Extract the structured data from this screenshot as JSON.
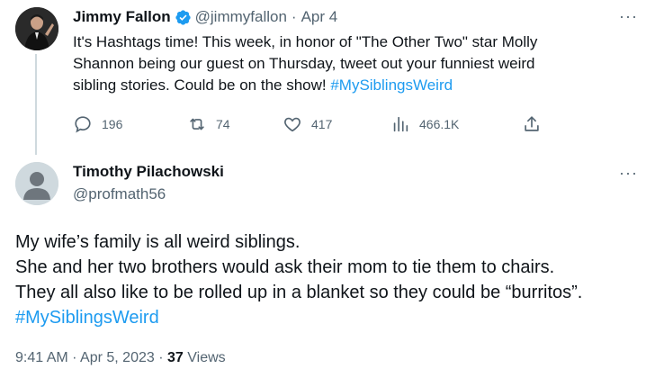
{
  "original_tweet": {
    "author_name": "Jimmy Fallon",
    "handle": "@jimmyfallon",
    "separator": "·",
    "date": "Apr 4",
    "text_line1": "It's Hashtags time! This week, in honor of \"The Other Two\" star Molly",
    "text_line2": "Shannon being our guest on Thursday, tweet out your funniest weird",
    "text_line3_prefix": "sibling stories. Could be on the show! ",
    "hashtag": "#MySiblingsWeird",
    "more": "···",
    "actions": {
      "replies": "196",
      "retweets": "74",
      "likes": "417",
      "views": "466.1K"
    }
  },
  "reply_tweet": {
    "author_name": "Timothy Pilachowski",
    "handle": "@profmath56",
    "more": "···",
    "text_line1": "My wife’s family is all weird siblings.",
    "text_line2": "She and her two brothers would ask their mom to tie them to chairs.",
    "text_line3": "They all also like to be rolled up in a blanket so they could be “burritos”.",
    "hashtag": "#MySiblingsWeird",
    "meta": {
      "time": "9:41 AM",
      "separator": "·",
      "date": "Apr 5, 2023",
      "separator2": "·",
      "views_count": "37",
      "views_label": "Views"
    }
  },
  "colors": {
    "accent": "#1d9bf0",
    "verified": "#1d9bf0",
    "secondary_text": "#536471",
    "primary_text": "#0f1419"
  },
  "icons": [
    "verified-badge-icon",
    "reply-icon",
    "retweet-icon",
    "like-icon",
    "views-icon",
    "share-icon",
    "more-icon"
  ]
}
